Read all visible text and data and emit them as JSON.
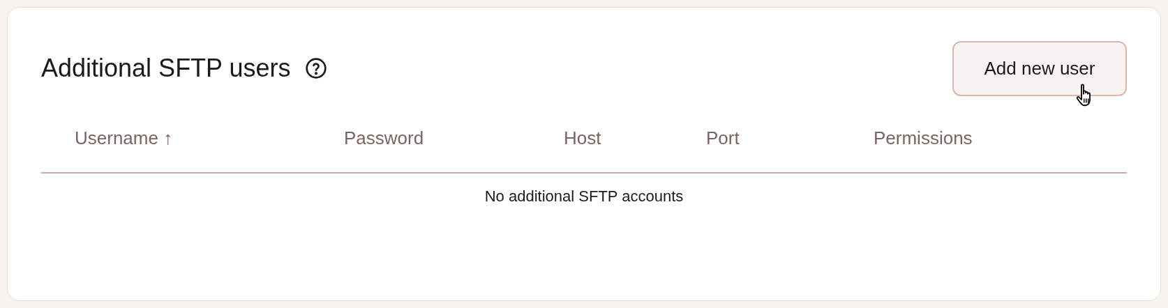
{
  "section": {
    "title": "Additional SFTP users"
  },
  "add_button": {
    "label": "Add new user"
  },
  "table": {
    "columns": [
      {
        "label": "Username ↑"
      },
      {
        "label": "Password"
      },
      {
        "label": "Host"
      },
      {
        "label": "Port"
      },
      {
        "label": "Permissions"
      }
    ],
    "empty_message": "No additional SFTP accounts"
  }
}
